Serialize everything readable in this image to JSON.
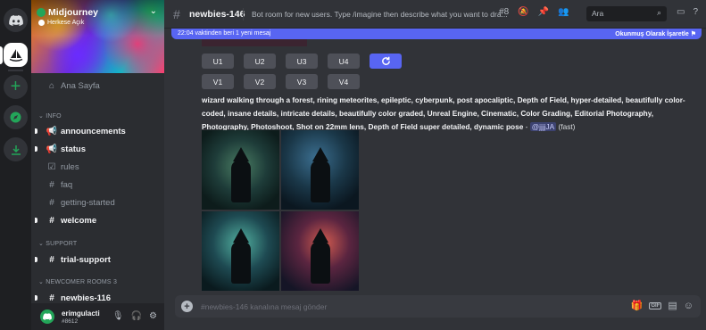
{
  "server": {
    "name": "Midjourney",
    "visibility": "Herkese Açık"
  },
  "sidebar": {
    "home": "Ana Sayfa",
    "categories": {
      "info": "INFO",
      "support": "SUPPORT",
      "newcomer": "NEWCOMER ROOMS 3"
    },
    "channels": [
      {
        "name": "announcements",
        "icon": "megaphone-icon",
        "unread": true
      },
      {
        "name": "status",
        "icon": "megaphone-icon",
        "unread": true
      },
      {
        "name": "rules",
        "icon": "checkbox-icon",
        "unread": false
      },
      {
        "name": "faq",
        "icon": "hash-icon",
        "unread": false
      },
      {
        "name": "getting-started",
        "icon": "hash-icon",
        "unread": false
      },
      {
        "name": "welcome",
        "icon": "hash-icon",
        "unread": true
      },
      {
        "name": "trial-support",
        "icon": "hash-thread-icon",
        "unread": true
      },
      {
        "name": "newbies-116",
        "icon": "hash-thread-icon",
        "unread": true
      }
    ]
  },
  "user": {
    "name": "erimgulacti",
    "tag": "#8612"
  },
  "header": {
    "channel": "newbies-146",
    "topic": "Bot room for new users. Type /imagine then describe what you want to dra...",
    "thread_count": "8",
    "search_placeholder": "Ara"
  },
  "new_messages_bar": {
    "text": "22:04 vaktinden beri 1 yeni mesaj",
    "mark_read": "Okunmuş Olarak İşaretle"
  },
  "buttons": {
    "upscale": [
      "U1",
      "U2",
      "U3",
      "U4"
    ],
    "variation": [
      "V1",
      "V2",
      "V3",
      "V4"
    ]
  },
  "message": {
    "prompt": "wizard walking through a forest, rining meteorites, epileptic, cyberpunk, post apocaliptic, Depth of Field, hyper-detailed, beautifully color-coded, insane details, intricate details, beautifully color graded, Unreal Engine, Cinematic, Color Grading, Editorial Photography, Photography, Photoshoot, Shot on 22mm lens, Depth of Field super detailed, dynamic pose",
    "separator": " - ",
    "mention": "@jjjjJA",
    "speed": "(fast)"
  },
  "composer": {
    "placeholder": "#newbies-146 kanalına mesaj gönder"
  },
  "colors": {
    "blurple": "#5865f2",
    "green": "#23a559",
    "bg": "#313338",
    "sidebar": "#2b2d31"
  }
}
